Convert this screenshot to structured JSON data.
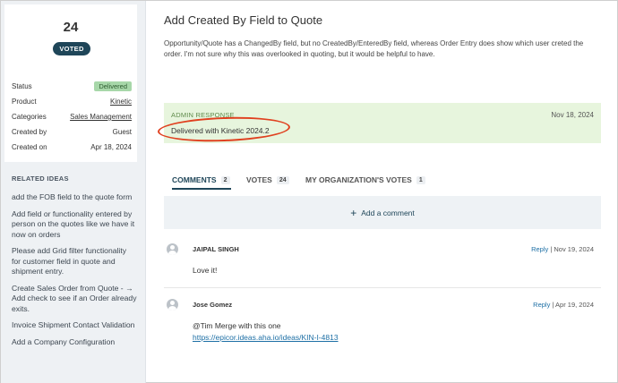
{
  "sidebar": {
    "vote_count": "24",
    "voted_label": "VOTED",
    "meta": [
      {
        "label": "Status",
        "value": "Delivered",
        "kind": "badge"
      },
      {
        "label": "Product",
        "value": "Kinetic",
        "kind": "link"
      },
      {
        "label": "Categories",
        "value": "Sales Management",
        "kind": "link"
      },
      {
        "label": "Created by",
        "value": "Guest",
        "kind": "text"
      },
      {
        "label": "Created on",
        "value": "Apr 18, 2024",
        "kind": "text"
      }
    ],
    "related_title": "RELATED IDEAS",
    "related": [
      "add the FOB field to the quote form",
      "Add field or functionality entered by person on the quotes like we have it now on orders",
      "Please add Grid filter functionality for customer field in quote and shipment entry.",
      "Create Sales Order from Quote - → Add check to see if an Order already exits.",
      "Invoice Shipment Contact Validation",
      "Add a Company Configuration"
    ]
  },
  "idea": {
    "title": "Add Created By Field to Quote",
    "description": "Opportunity/Quote has a ChangedBy field, but no CreatedBy/EnteredBy field, whereas Order Entry does show which user creted the order. I'm not sure why this was overlooked in quoting, but it would be helpful to have."
  },
  "admin": {
    "label": "ADMIN RESPONSE",
    "date": "Nov 18, 2024",
    "text": "Delivered with Kinetic 2024.2"
  },
  "tabs": [
    {
      "label": "COMMENTS",
      "count": "2"
    },
    {
      "label": "VOTES",
      "count": "24"
    },
    {
      "label": "MY ORGANIZATION'S VOTES",
      "count": "1"
    }
  ],
  "add_comment_label": "Add a comment",
  "comments": [
    {
      "author": "JAIPAL SINGH",
      "reply": "Reply",
      "date": "Nov 19, 2024",
      "body": "Love it!"
    },
    {
      "author": "Jose Gomez",
      "reply": "Reply",
      "date": "Apr 19, 2024",
      "body": "@Tim Merge with this one",
      "link": "https://epicor.ideas.aha.io/ideas/KIN-I-4813"
    }
  ],
  "colors": {
    "accent": "#1f4659",
    "admin_bg": "#e7f5dd",
    "badge_bg": "#a7d7a9",
    "annotation": "#e0401f",
    "link": "#1d6fa5"
  }
}
